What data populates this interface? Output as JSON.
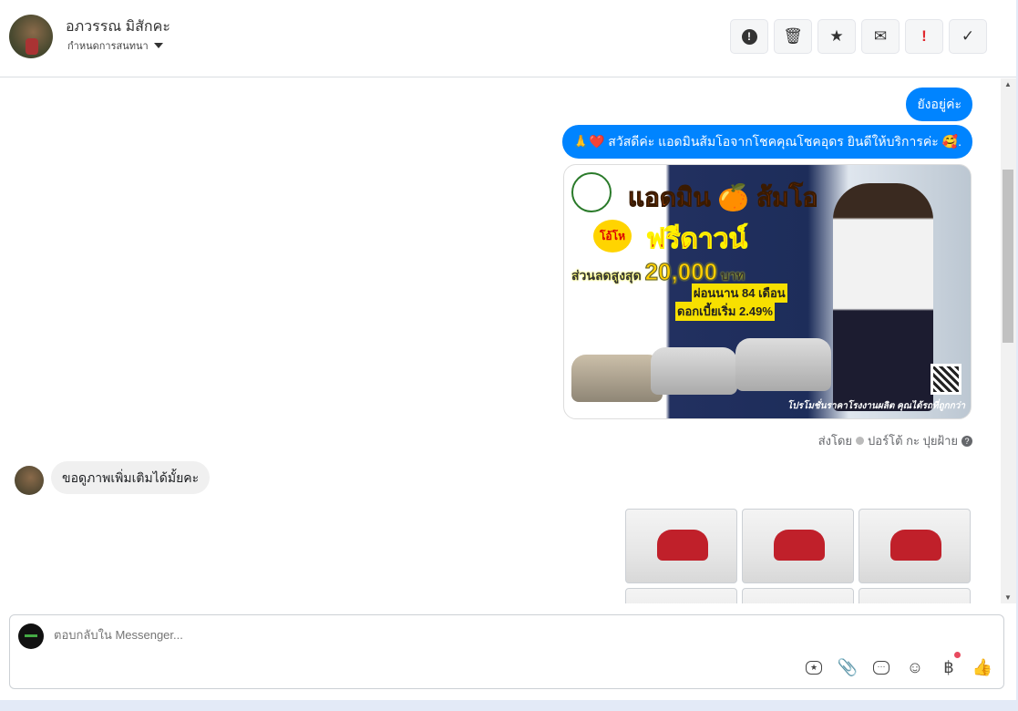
{
  "header": {
    "contact_name": "อภวรรณ มิสักคะ",
    "assign_label": "กำหนดการสนทนา",
    "actions": [
      {
        "name": "spam",
        "icon": "!"
      },
      {
        "name": "delete",
        "icon": "🗑"
      },
      {
        "name": "star",
        "icon": "★"
      },
      {
        "name": "mark-unread",
        "icon": "✉"
      },
      {
        "name": "important",
        "icon": "!"
      },
      {
        "name": "done",
        "icon": "✓"
      }
    ]
  },
  "messages": {
    "out1": "ยังอยู่ค่ะ",
    "out2": "🙏❤️ สวัสดีค่ะ แอดมินส้มโอจากโชคคุณโชคอุดร ยินดีให้บริการค่ะ 🥰.",
    "ad": {
      "title": "แอดมิน 🍊 ส้มโอ",
      "burst": "โอ้โห",
      "headline": "ฟรีดาวน์",
      "discount_label": "ส่วนลดสูงสุด",
      "discount_value": "20,000",
      "discount_unit": "บาท",
      "installment": "ผ่อนนาน 84 เดือน",
      "interest": "ดอกเบี้ยเริ่ม 2.49%",
      "footer": "โปรโมชั่นราคาโรงงานผลิต คุณได้รถที่ถูกกว่า"
    },
    "sent_by_label": "ส่งโดย",
    "sent_by_name": "ปอร์โต้ กะ ปุยฝ้าย",
    "in1": "ขอดูภาพเพิ่มเติมได้มั้ยคะ"
  },
  "composer": {
    "placeholder": "ตอบกลับใน Messenger...",
    "currency_icon": "฿"
  },
  "colors": {
    "accent": "#0084ff",
    "important": "#e0282e"
  }
}
